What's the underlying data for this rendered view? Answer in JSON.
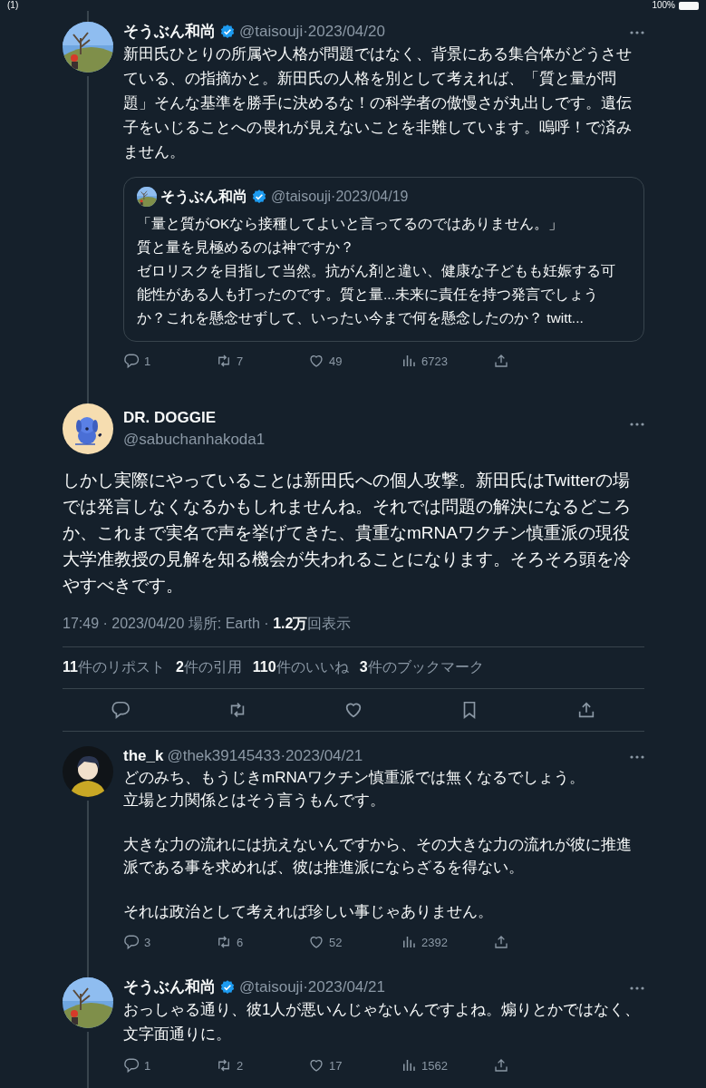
{
  "status_bar": {
    "left": "(1)",
    "battery": "100%"
  },
  "tweets": [
    {
      "kind": "reply",
      "thread_above": true,
      "thread_below": true,
      "name": "そうぶん和尚",
      "verified": true,
      "meta": "@taisouji·2023/04/20",
      "text": "新田氏ひとりの所属や人格が問題ではなく、背景にある集合体がどうさせている、の指摘かと。新田氏の人格を別として考えれば、「質と量が問題」そんな基準を勝手に決めるな！の科学者の傲慢さが丸出しです。遺伝子をいじることへの畏れが見えないことを非難しています。嗚呼！で済みません。",
      "quote": {
        "name": "そうぶん和尚",
        "verified": true,
        "meta": "@taisouji·2023/04/19",
        "lines": [
          "「量と質がOKなら接種してよいと言ってるのではありません。」",
          "質と量を見極めるのは神ですか？",
          "ゼロリスクを目指して当然。抗がん剤と違い、健康な子どもも妊娠する可能性がある人も打ったのです。質と量...未来に責任を持つ発言でしょうか？これを懸念せずして、いったい今まで何を懸念したのか？ twitt..."
        ]
      },
      "actions": {
        "replies": "1",
        "reposts": "7",
        "likes": "49",
        "views": "6723"
      }
    },
    {
      "kind": "main",
      "avatar": {
        "kind": "dog"
      },
      "thread_above": true,
      "thread_below": false,
      "name": "DR. DOGGIE",
      "verified": false,
      "handle": "@sabuchanhakoda1",
      "text": "しかし実際にやっていることは新田氏への個人攻撃。新田氏はTwitterの場では発言しなくなるかもしれませんね。それでは問題の解決になるどころか、これまで実名で声を挙げてきた、貴重なmRNAワクチン慎重派の現役大学准教授の見解を知る機会が失われることになります。そろそろ頭を冷やすべきです。",
      "info": "17:49 · 2023/04/20 場所: Earth · **1.2万**回表示",
      "stats": [
        "**11**件のリポスト",
        "**2**件の引用",
        "**110**件のいいね",
        "**3**件のブックマーク"
      ]
    },
    {
      "kind": "reply",
      "avatar": {
        "kind": "person"
      },
      "thread_above": false,
      "thread_below": true,
      "name": "the_k",
      "verified": false,
      "meta": "@thek39145433·2023/04/21",
      "paragraphs": [
        [
          "どのみち、もうじきmRNAワクチン慎重派では無くなるでしょう。",
          "立場と力関係とはそう言うもんです。"
        ],
        [
          "大きな力の流れには抗えないんですから、その大きな力の流れが彼に推進派である事を求めれば、彼は推進派にならざるを得ない。"
        ],
        [
          "それは政治として考えれば珍しい事じゃありません。"
        ]
      ],
      "actions": {
        "replies": "3",
        "reposts": "6",
        "likes": "52",
        "views": "2392"
      }
    },
    {
      "kind": "reply",
      "thread_above": true,
      "thread_below": true,
      "name": "そうぶん和尚",
      "verified": true,
      "meta": "@taisouji·2023/04/21",
      "text": "おっしゃる通り、彼1人が悪いんじゃないんですよね。煽りとかではなく、文字面通りに。",
      "actions": {
        "replies": "1",
        "reposts": "2",
        "likes": "17",
        "views": "1562"
      }
    }
  ]
}
